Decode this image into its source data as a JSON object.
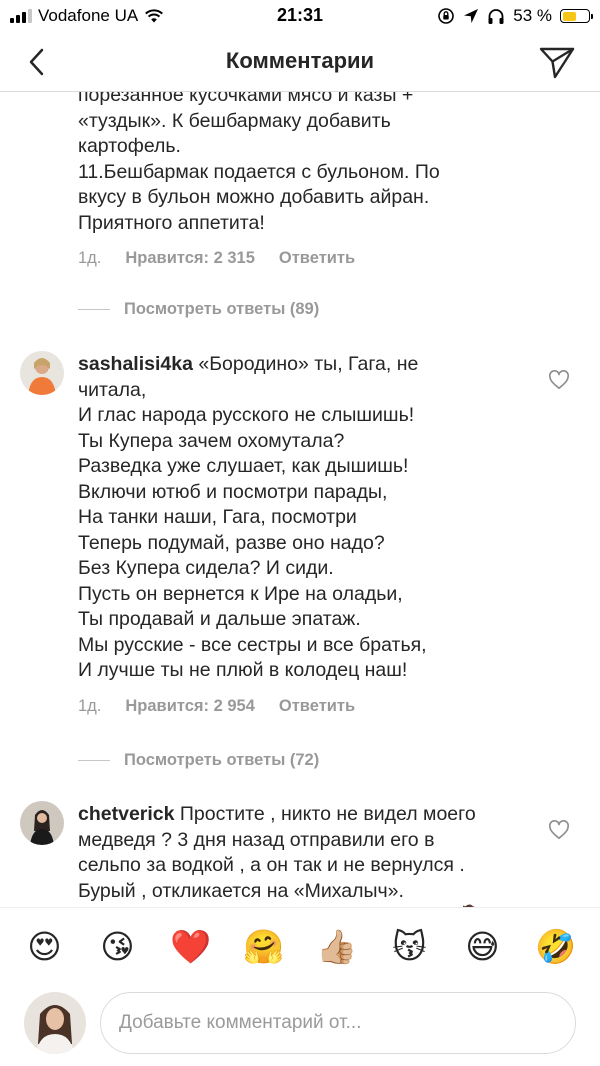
{
  "status_bar": {
    "carrier": "Vodafone UA",
    "time": "21:31",
    "battery_percent": "53 %",
    "battery_level": 0.53,
    "battery_color": "#f5c518",
    "icons": [
      "signal-icon",
      "wifi-icon",
      "orientation-lock-icon",
      "location-icon",
      "headphones-icon",
      "battery-icon"
    ]
  },
  "header": {
    "title": "Комментарии",
    "back_icon": "chevron-left-icon",
    "send_icon": "paper-plane-icon"
  },
  "comments": [
    {
      "username": "",
      "text": "порезанное кусочками мясо и казы +\n«туздык». К бешбармаку добавить\nкартофель.\n11.Бешбармак подается с бульоном. По\nвкусу в бульон можно добавить айран.\nПриятного аппетита!",
      "time": "1д.",
      "likes": "Нравится: 2 315",
      "reply": "Ответить",
      "view_replies": "Посмотреть ответы (89)"
    },
    {
      "username": "sashalisi4ka",
      "text": "«Бородино» ты, Гага, не\nчитала,\nИ глас народа русского не слышишь!\nТы Купера зачем охомутала?\nРазведка уже слушает, как дышишь!\nВключи ютюб и посмотри парады,\nНа танки наши, Гага, посмотри\nТеперь подумай, разве оно надо?\nБез Купера сидела? И сиди.\nПусть он вернется к Ире на оладьи,\nТы продавай и дальше эпатаж.\nМы русские - все сестры и все братья,\nИ лучше ты не плюй в колодец наш!",
      "time": "1д.",
      "likes": "Нравится: 2 954",
      "reply": "Ответить",
      "view_replies": "Посмотреть ответы (72)"
    },
    {
      "username": "chetverick",
      "text": "Простите , никто не видел моего\nмедведя ? 3 дня назад отправили его в\nсельпо за водкой , а он так и не вернулся .\nБурый , откликается на «Михалыч».\nНенароком думаю , может Гага его увела 🤷",
      "time": "",
      "likes": "",
      "reply": "",
      "view_replies": ""
    }
  ],
  "emoji_bar": [
    "😍",
    "😘",
    "❤️",
    "🤗",
    "👍🏼",
    "😽",
    "😅",
    "🤣"
  ],
  "composer": {
    "placeholder": "Добавьте комментарий от..."
  }
}
